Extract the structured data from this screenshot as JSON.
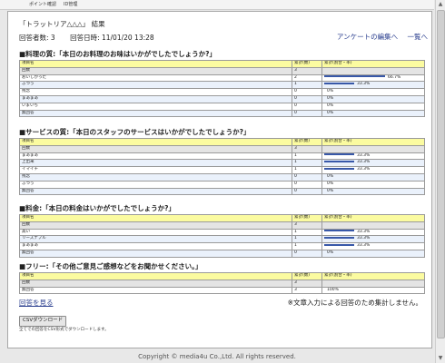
{
  "topbar": {
    "tab1": "ポイント確認",
    "tab2": "ID管理"
  },
  "title": "「トラットリア△△△」 結果",
  "meta": {
    "respondents": "回答者数: 3",
    "date": "回答日時: 11/01/20 13:28"
  },
  "links": {
    "edit": "アンケートの編集へ",
    "list": "一覧へ"
  },
  "columns": [
    "項目名",
    "累計(数)",
    "累計(割合・率)"
  ],
  "sections": [
    {
      "heading": "■料理の質:「本日のお料理のお味はいかがでしたでしょうか?」",
      "total": {
        "label": "回数",
        "count": "3",
        "pct": ""
      },
      "rows": [
        {
          "label": "おいしかった",
          "count": "2",
          "pct": "66.7%",
          "ratio": 0.667
        },
        {
          "label": "ふつう",
          "count": "1",
          "pct": "33.3%",
          "ratio": 0.333
        },
        {
          "label": "残念",
          "count": "0",
          "pct": "0%",
          "ratio": 0
        },
        {
          "label": "まあまあ",
          "count": "0",
          "pct": "0%",
          "ratio": 0
        },
        {
          "label": "いまいち",
          "count": "0",
          "pct": "0%",
          "ratio": 0
        },
        {
          "label": "無回答",
          "count": "0",
          "pct": "0%",
          "ratio": 0
        }
      ]
    },
    {
      "heading": "■サービスの質:「本日のスタッフのサービスはいかがでしたでしょうか?」",
      "total": {
        "label": "回数",
        "count": "3",
        "pct": ""
      },
      "rows": [
        {
          "label": "まあまあ",
          "count": "1",
          "pct": "33.3%",
          "ratio": 0.333
        },
        {
          "label": "上出来",
          "count": "1",
          "pct": "33.3%",
          "ratio": 0.333
        },
        {
          "label": "イマイチ",
          "count": "1",
          "pct": "33.3%",
          "ratio": 0.333
        },
        {
          "label": "残念",
          "count": "0",
          "pct": "0%",
          "ratio": 0
        },
        {
          "label": "ふつう",
          "count": "0",
          "pct": "0%",
          "ratio": 0
        },
        {
          "label": "無回答",
          "count": "0",
          "pct": "0%",
          "ratio": 0
        }
      ]
    },
    {
      "heading": "■料金:「本日の料金はいかがでしたでしょうか?」",
      "total": {
        "label": "回数",
        "count": "3",
        "pct": ""
      },
      "rows": [
        {
          "label": "高い",
          "count": "1",
          "pct": "33.3%",
          "ratio": 0.333
        },
        {
          "label": "リーズナブル",
          "count": "1",
          "pct": "33.3%",
          "ratio": 0.333
        },
        {
          "label": "まあまあ",
          "count": "1",
          "pct": "33.3%",
          "ratio": 0.333
        },
        {
          "label": "無回答",
          "count": "0",
          "pct": "0%",
          "ratio": 0
        }
      ]
    },
    {
      "heading": "■フリー:「その他ご意見ご感想などをお聞かせください。」",
      "total": {
        "label": "回数",
        "count": "3",
        "pct": ""
      },
      "rows": [
        {
          "label": "無回答",
          "count": "3",
          "pct": "100%",
          "ratio": 0
        }
      ]
    }
  ],
  "back_link": "回答を見る",
  "note": "※文章入力による回答のため集計しません。",
  "csv": {
    "button": "CSVダウンロード",
    "note": "全てでの回答をCSV形式でダウンロードします。"
  },
  "footer": "Copyright © media4u Co.,Ltd. All rights reserved.",
  "colors": {
    "header_row": "#fbfba0",
    "alt_row": "#eaf1fb",
    "bar": "#3858a8",
    "link": "#2b3f8f"
  }
}
